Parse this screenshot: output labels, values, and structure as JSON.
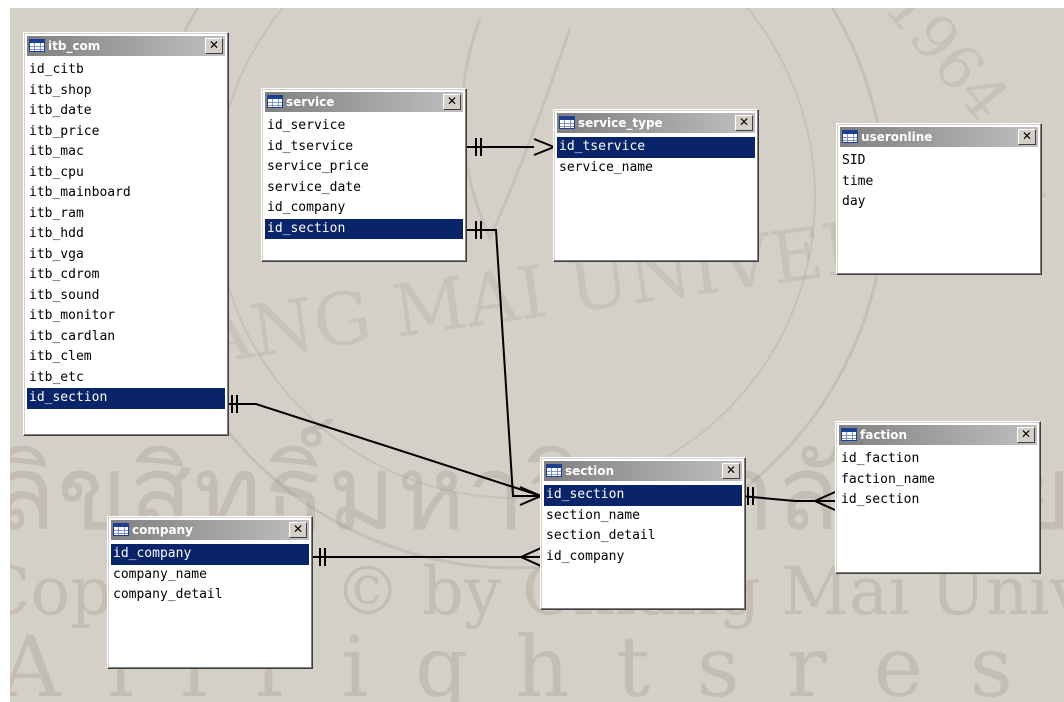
{
  "colors": {
    "canvas": "#d4d0c8",
    "title_gradient_start": "#808080",
    "title_gradient_end": "#c0c0c0",
    "selection": "#0a246a",
    "line": "#000000"
  },
  "watermark": {
    "thai_line": "ลิขสิทธิ์มหาวิทยาลัยเชียงใหม่",
    "copyright_line": "Copyright © by Chiang Mai University",
    "rights_line": "A l l  r i g h t s  r e s e r v e d",
    "seal_text": "CHIANG MAI UNIVERSITY",
    "seal_year": "1964"
  },
  "tables": {
    "itb_com": {
      "name": "itb_com",
      "fields": [
        "id_citb",
        "itb_shop",
        "itb_date",
        "itb_price",
        "itb_mac",
        "itb_cpu",
        "itb_mainboard",
        "itb_ram",
        "itb_hdd",
        "itb_vga",
        "itb_cdrom",
        "itb_sound",
        "itb_monitor",
        "itb_cardlan",
        "itb_clem",
        "itb_etc",
        "id_section"
      ],
      "selected": "id_section"
    },
    "service": {
      "name": "service",
      "fields": [
        "id_service",
        "id_tservice",
        "service_price",
        "service_date",
        "id_company",
        "id_section"
      ],
      "selected": "id_section"
    },
    "service_type": {
      "name": "service_type",
      "fields": [
        "id_tservice",
        "service_name"
      ],
      "selected": "id_tservice"
    },
    "useronline": {
      "name": "useronline",
      "fields": [
        "SID",
        "time",
        "day"
      ],
      "selected": ""
    },
    "section": {
      "name": "section",
      "fields": [
        "id_section",
        "section_name",
        "section_detail",
        "id_company"
      ],
      "selected": "id_section"
    },
    "faction": {
      "name": "faction",
      "fields": [
        "id_faction",
        "faction_name",
        "id_section"
      ],
      "selected": ""
    },
    "company": {
      "name": "company",
      "fields": [
        "id_company",
        "company_name",
        "company_detail"
      ],
      "selected": "id_company"
    }
  },
  "close_glyph": "✕",
  "relationships": [
    {
      "from": "service.id_tservice",
      "to": "service_type.id_tservice"
    },
    {
      "from": "service.id_section",
      "to": "section.id_section"
    },
    {
      "from": "itb_com.id_section",
      "to": "section.id_section"
    },
    {
      "from": "faction.id_section",
      "to": "section.id_section"
    },
    {
      "from": "company.id_company",
      "to": "section.id_company"
    }
  ]
}
